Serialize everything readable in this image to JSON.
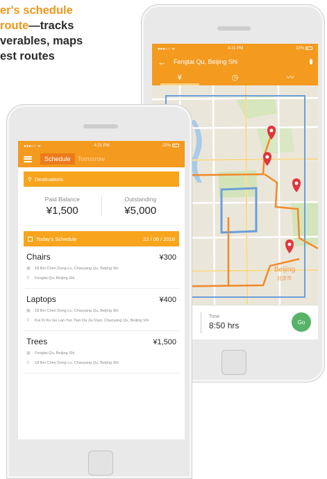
{
  "headline": {
    "line1": "er's schedule",
    "line2_orange": "route",
    "line2_rest": "—tracks",
    "line3": "verables, maps",
    "line4": "est routes"
  },
  "colors": {
    "accent_orange": "#f39a1f",
    "bar_orange": "#f7a51d",
    "go_green": "#58b368",
    "route_orange": "#ef8a2a",
    "route_blue": "#6a9fd8",
    "pin_red": "#e0363d"
  },
  "map_screen": {
    "status": {
      "left": "●●●○○  ᯤ",
      "time": "4:21 PM",
      "battery": "22%"
    },
    "title": "Fengtai Qu, Beijing Shi",
    "back_icon": "arrow-left-icon",
    "mic_icon": "microphone-icon",
    "tabs": [
      {
        "icon": "yen-icon",
        "glyph": "¥"
      },
      {
        "icon": "stopwatch-icon",
        "glyph": "◷"
      },
      {
        "icon": "route-icon",
        "glyph": "〰"
      }
    ],
    "map_labels": {
      "beijing": "Beijing",
      "beijing_cn": "北京市"
    },
    "time_label": "Time",
    "time_value": "8:50 hrs",
    "go_label": "Go"
  },
  "schedule_screen": {
    "status": {
      "left": "●●●○○  ᯤ",
      "time": "4:21 PM",
      "battery": "22%"
    },
    "tab_active": "Schedule",
    "tab_inactive": "Tomorrow",
    "destinations_label": "Destinations",
    "paid_label": "Paid Balance",
    "paid_value": "¥1,500",
    "outstanding_label": "Outstanding",
    "outstanding_value": "¥5,000",
    "today_label": "Today's Schedule",
    "today_date": "22 / 06 / 2016",
    "items": [
      {
        "name": "Chairs",
        "price": "¥300",
        "from": "18 Bei Chen Dong Lu, Chaoyang Qu, Beijing Shi",
        "to": "Fengtai Qu, Beijing Shi"
      },
      {
        "name": "Laptops",
        "price": "¥400",
        "from": "18 Bei Chen Dong Lu, Chaoyang Qu, Beijing Shi",
        "to": "Kai Di Ke Ge Lan Yun Tian Da Jiu Dian, Chaoyang Qu, Beijing Shi"
      },
      {
        "name": "Trees",
        "price": "¥1,500",
        "from": "Fengtai Qu, Beijing Shi",
        "to": "18 Bei Chen Dong Lu, Chaoyang Qu, Beijing Shi"
      }
    ]
  }
}
